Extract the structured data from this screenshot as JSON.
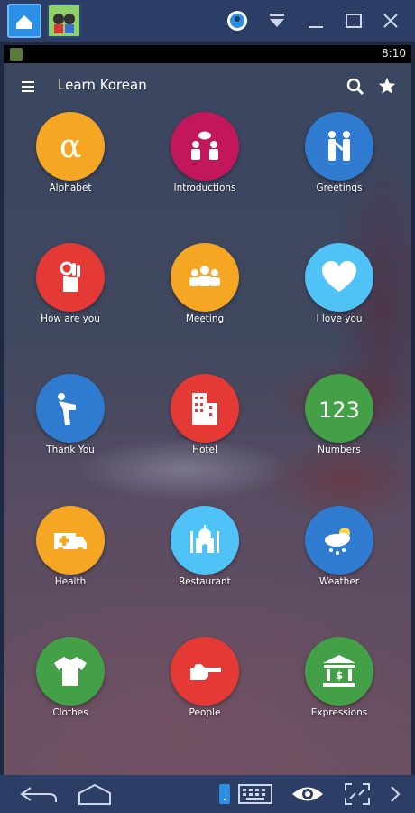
{
  "emulator": {
    "controls": [
      "user-icon",
      "download-icon",
      "minimize-icon",
      "maximize-icon",
      "close-icon"
    ],
    "bottom": [
      "back-icon",
      "home-icon",
      "keyboard-icon",
      "eye-icon",
      "fullscreen-icon",
      "chevron-right-icon"
    ]
  },
  "status": {
    "time": "8:10"
  },
  "appbar": {
    "title": "Learn Korean",
    "icons": [
      "menu-icon",
      "search-icon",
      "star-icon"
    ]
  },
  "tiles": [
    {
      "label": "Alphabet",
      "color": "#f5a623",
      "icon": "alpha-icon"
    },
    {
      "label": "Introductions",
      "color": "#c2185b",
      "icon": "people-talking-icon"
    },
    {
      "label": "Greetings",
      "color": "#2e7bcf",
      "icon": "handshake-icon"
    },
    {
      "label": "How are you",
      "color": "#e53935",
      "icon": "ok-hand-icon"
    },
    {
      "label": "Meeting",
      "color": "#f5a623",
      "icon": "group-icon"
    },
    {
      "label": "I love you",
      "color": "#4fc3f7",
      "icon": "heart-icon"
    },
    {
      "label": "Thank You",
      "color": "#2e7bcf",
      "icon": "bow-icon"
    },
    {
      "label": "Hotel",
      "color": "#e53935",
      "icon": "building-icon"
    },
    {
      "label": "Numbers",
      "color": "#43a047",
      "icon": "numbers-icon",
      "glyph": "123"
    },
    {
      "label": "Health",
      "color": "#f5a623",
      "icon": "ambulance-icon"
    },
    {
      "label": "Restaurant",
      "color": "#4fc3f7",
      "icon": "taj-mahal-icon"
    },
    {
      "label": "Weather",
      "color": "#2e7bcf",
      "icon": "weather-icon"
    },
    {
      "label": "Clothes",
      "color": "#43a047",
      "icon": "tshirt-icon"
    },
    {
      "label": "People",
      "color": "#e53935",
      "icon": "pointing-hand-icon"
    },
    {
      "label": "Expressions",
      "color": "#43a047",
      "icon": "bank-icon"
    }
  ]
}
